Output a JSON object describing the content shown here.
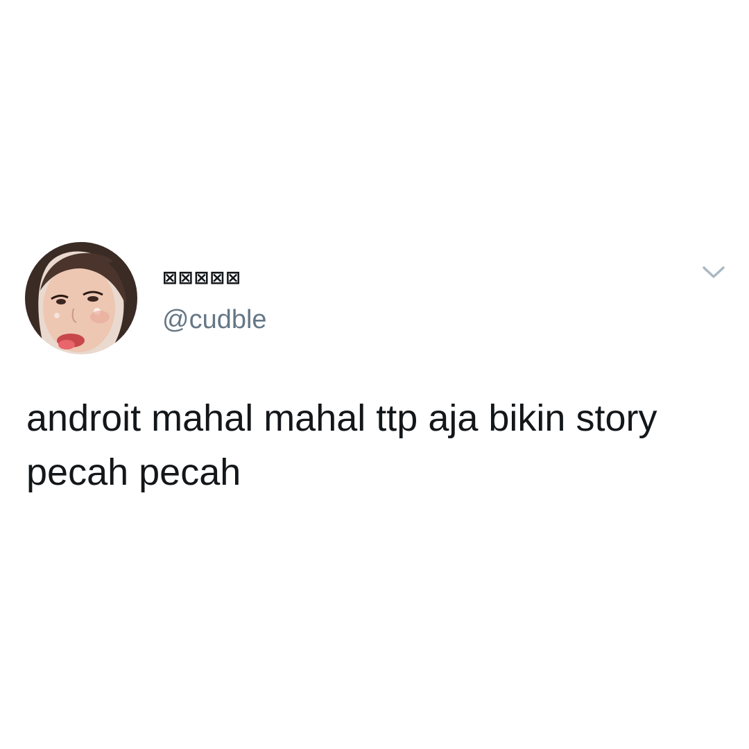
{
  "tweet": {
    "display_name": "⊠⊠⊠⊠⊠",
    "handle": "@cudble",
    "text": "androit mahal mahal ttp aja bikin story pecah pecah",
    "menu_icon": "chevron-down-icon",
    "avatar_icon": "avatar"
  },
  "colors": {
    "background": "#ffffff",
    "text_primary": "#14171a",
    "text_secondary": "#657786",
    "chevron": "#aab8c2"
  }
}
